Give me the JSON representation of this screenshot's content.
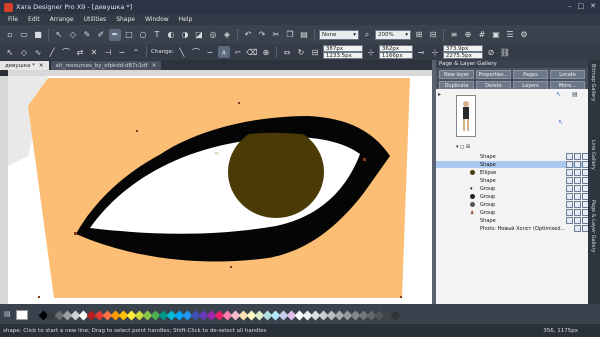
{
  "app": {
    "title": "Xara Designer Pro X9 - [девушка *]"
  },
  "window_controls": [
    "–",
    "□",
    "✕"
  ],
  "menu": [
    "File",
    "Edit",
    "Arrange",
    "Utilities",
    "Shape",
    "Window",
    "Help"
  ],
  "toolbar1": {
    "zoom_combo": "None",
    "zoom_percent": "200%"
  },
  "toolbar2": {
    "change_label": "Change:",
    "width_field": "387px",
    "height_field": "1233.5px",
    "x_field": "362px",
    "y_field": "1166px",
    "x2_field": "373.9px",
    "y2_field": "2275.5px"
  },
  "tabs": {
    "active": "девушка *",
    "inactive": "alt_resources_by_ofpkdd-d87c1df"
  },
  "panel": {
    "title": "Page & Layer Gallery",
    "buttons": [
      "New layer",
      "Properties...",
      "Pages",
      "Locate",
      "Duplicate",
      "Delete",
      "Layers",
      "More..."
    ],
    "layers": [
      {
        "name": "Shape",
        "selected": false
      },
      {
        "name": "Shape",
        "selected": true
      },
      {
        "name": "Ellipse",
        "selected": false
      },
      {
        "name": "Shape",
        "selected": false
      },
      {
        "name": "Group",
        "selected": false
      },
      {
        "name": "Group",
        "selected": false
      },
      {
        "name": "Group",
        "selected": false
      },
      {
        "name": "Group",
        "selected": false
      },
      {
        "name": "Shape",
        "selected": false
      },
      {
        "name": "Photo: Новый Холст (Optimised...",
        "selected": false
      }
    ]
  },
  "side_tabs": [
    "Bitmap Gallery",
    "Line Gallery",
    "Page & Layer Gallery"
  ],
  "palette": {
    "colors": [
      "#000000",
      "#3a3a3a",
      "#6e6e6e",
      "#a0a0a0",
      "#d0d0d0",
      "#ffffff",
      "#b71c1c",
      "#e53935",
      "#ff7043",
      "#ff9800",
      "#ffc107",
      "#ffeb3b",
      "#cddc39",
      "#8bc34a",
      "#4caf50",
      "#009688",
      "#00bcd4",
      "#03a9f4",
      "#2196f3",
      "#3f51b5",
      "#673ab7",
      "#9c27b0",
      "#e91e63",
      "#ff80ab",
      "#f8bbd0",
      "#ffe0b2",
      "#fff9c4",
      "#dcedc8",
      "#b2dfdb",
      "#b3e5fc",
      "#c5cae9",
      "#e1bee7",
      "#ffffff",
      "#eeeeee",
      "#dddddd",
      "#cccccc",
      "#bbbbbb",
      "#aaaaaa",
      "#999999",
      "#888888",
      "#777777",
      "#666666",
      "#555555",
      "#444444",
      "#333333"
    ]
  },
  "status": {
    "text": "shape: Click to start a new line; Drag to select point handles; Shift-Click to de-select all handles",
    "coords": "356, 1175px"
  },
  "colors": {
    "page_fill": "#fcbd74",
    "eye_outline": "#050505",
    "eye_white": "#ffffff",
    "iris": "#4a3b06",
    "selection_blue": "#a9c9ee"
  }
}
